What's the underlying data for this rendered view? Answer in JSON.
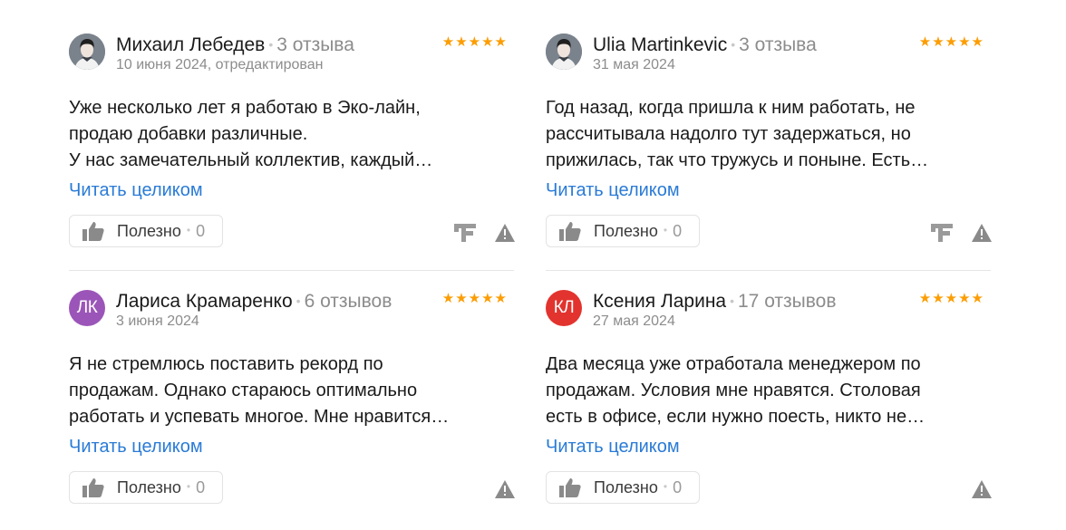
{
  "reviews": [
    {
      "name": "Михаил Лебедев",
      "count": "3 отзыва",
      "date": "10 июня 2024, отредактирован",
      "initials": "",
      "stars": "★★★★★",
      "lines": [
        "Уже несколько лет я работаю в Эко-лайн,",
        "продаю добавки различные.",
        "У нас замечательный коллектив, каждый…"
      ],
      "more": "Читать целиком",
      "useful_label": "Полезно",
      "useful_count": "0"
    },
    {
      "name": "Ulia Martinkevic",
      "count": "3 отзыва",
      "date": "31 мая 2024",
      "initials": "",
      "stars": "★★★★★",
      "lines": [
        "Год назад, когда пришла к ним работать, не",
        "рассчитывала надолго тут задержаться, но",
        "прижилась, так что тружусь и поныне. Есть…"
      ],
      "more": "Читать целиком",
      "useful_label": "Полезно",
      "useful_count": "0"
    },
    {
      "name": "Лариса Крамаренко",
      "count": "6 отзывов",
      "date": "3 июня 2024",
      "initials": "ЛК",
      "stars": "★★★★★",
      "lines": [
        "Я не стремлюсь поставить рекорд по",
        "продажам. Однако стараюсь оптимально",
        "работать и успевать многое. Мне нравится…"
      ],
      "more": "Читать целиком",
      "useful_label": "Полезно",
      "useful_count": "0"
    },
    {
      "name": "Ксения Ларина",
      "count": "17 отзывов",
      "date": "27 мая 2024",
      "initials": "КЛ",
      "stars": "★★★★★",
      "lines": [
        "Два месяца уже отработала менеджером по",
        "продажам. Условия мне нравятся. Столовая",
        "есть в офисе, если нужно поесть, никто не…"
      ],
      "more": "Читать целиком",
      "useful_label": "Полезно",
      "useful_count": "0"
    }
  ],
  "colors": {
    "link": "#2a7bd6",
    "star": "#fc9d03",
    "muted": "#8c8c8c"
  }
}
